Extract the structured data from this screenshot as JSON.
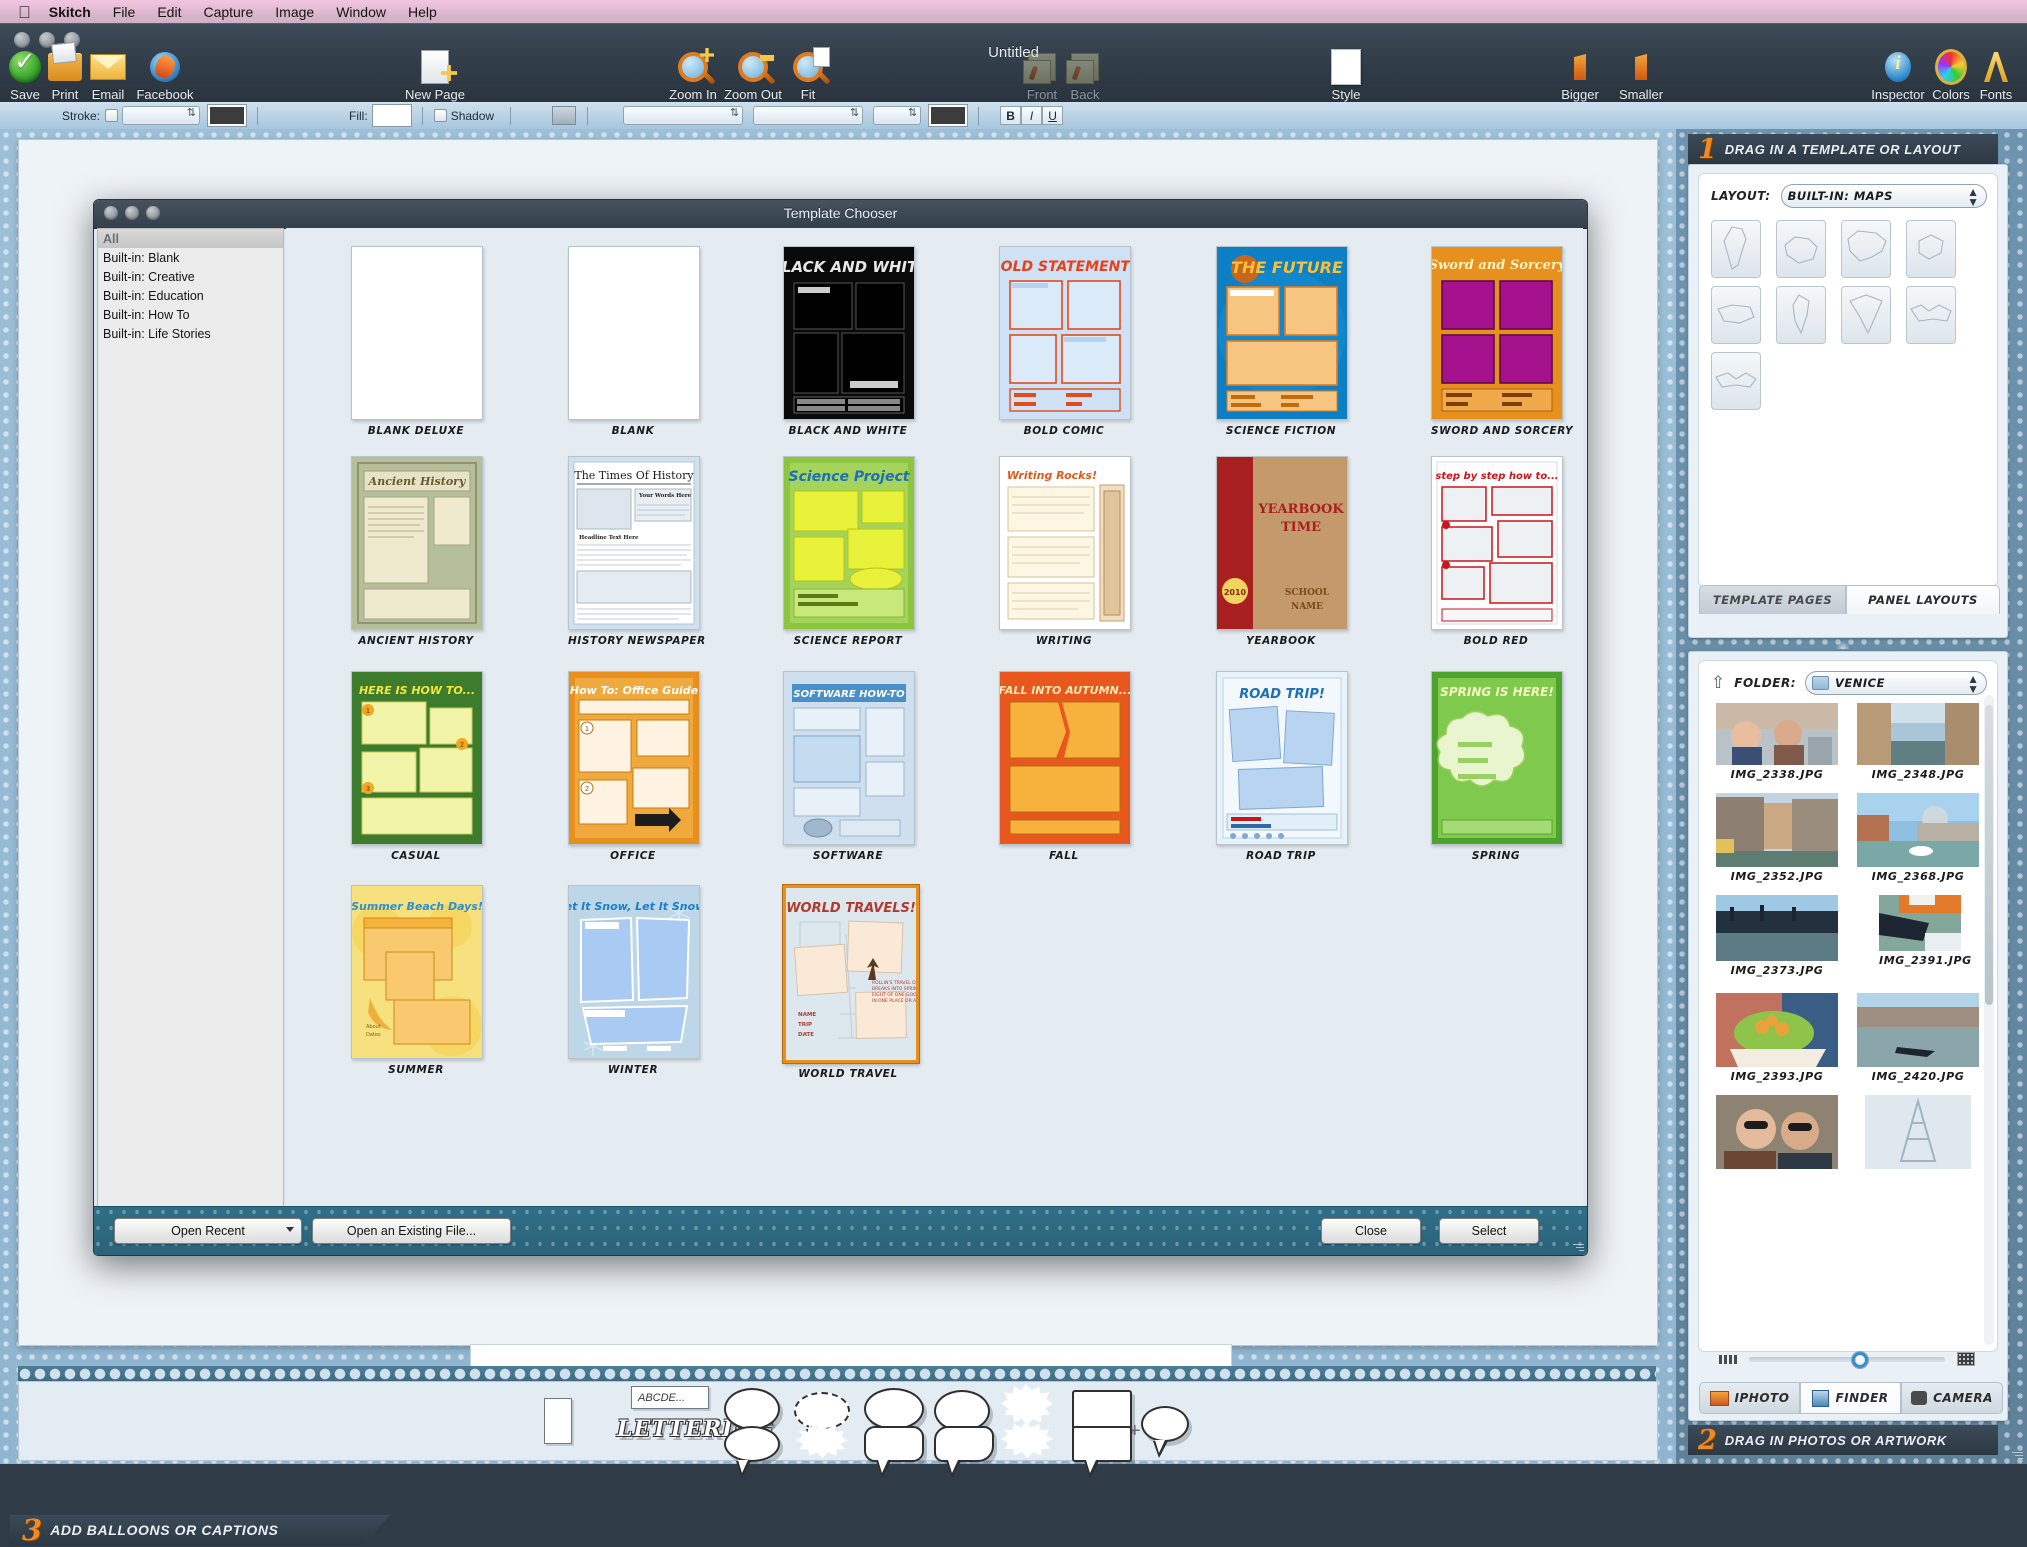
{
  "menubar": {
    "apple_icon": "apple-icon",
    "items": [
      {
        "label": "Skitch",
        "bold": true
      },
      {
        "label": "File"
      },
      {
        "label": "Edit"
      },
      {
        "label": "Capture"
      },
      {
        "label": "Image"
      },
      {
        "label": "Window"
      },
      {
        "label": "Help"
      }
    ]
  },
  "window": {
    "title": "Untitled",
    "toolbar": [
      {
        "label": "Save",
        "icon": "save-checkmark-icon",
        "enabled": true
      },
      {
        "label": "Print",
        "icon": "printer-icon",
        "enabled": true
      },
      {
        "label": "Email",
        "icon": "envelope-icon",
        "enabled": true
      },
      {
        "label": "Facebook",
        "icon": "facebook-globe-icon",
        "enabled": true
      },
      {
        "label": "New Page",
        "icon": "new-page-icon",
        "enabled": true
      },
      {
        "label": "Zoom In",
        "icon": "magnifier-plus-icon",
        "enabled": true
      },
      {
        "label": "Zoom Out",
        "icon": "magnifier-minus-icon",
        "enabled": true
      },
      {
        "label": "Fit",
        "icon": "magnifier-fit-icon",
        "enabled": true
      },
      {
        "label": "Front",
        "icon": "bring-front-icon",
        "enabled": false
      },
      {
        "label": "Back",
        "icon": "send-back-icon",
        "enabled": false
      },
      {
        "label": "Style",
        "icon": "style-swatch-icon",
        "enabled": true
      },
      {
        "label": "Bigger",
        "icon": "arrow-up-bigger-icon",
        "enabled": true
      },
      {
        "label": "Smaller",
        "icon": "arrow-down-smaller-icon",
        "enabled": true
      },
      {
        "label": "Inspector",
        "icon": "info-inspector-icon",
        "enabled": true
      },
      {
        "label": "Colors",
        "icon": "color-wheel-icon",
        "enabled": true
      },
      {
        "label": "Fonts",
        "icon": "font-a-icon",
        "enabled": true
      }
    ]
  },
  "format_bar": {
    "stroke_label": "Stroke:",
    "fill_label": "Fill:",
    "shadow_label": "Shadow",
    "stroke_color": "#3c3c3c",
    "fill_color": "#ffffff",
    "text_color": "#3c3c3c",
    "bold_label": "B",
    "italic_label": "I",
    "underline_label": "U"
  },
  "dialog": {
    "title": "Template Chooser",
    "sidebar": [
      {
        "label": "All",
        "selected": true
      },
      {
        "label": "Built-in: Blank",
        "selected": false
      },
      {
        "label": "Built-in: Creative",
        "selected": false
      },
      {
        "label": "Built-in: Education",
        "selected": false
      },
      {
        "label": "Built-in: How To",
        "selected": false
      },
      {
        "label": "Built-in: Life Stories",
        "selected": false
      }
    ],
    "buttons": {
      "open_recent": "Open Recent",
      "open_existing": "Open an Existing File...",
      "close": "Close",
      "select": "Select"
    },
    "templates": [
      {
        "name": "BLANK DELUXE",
        "style": "blank",
        "selected": false
      },
      {
        "name": "BLANK",
        "style": "blank",
        "selected": false
      },
      {
        "name": "BLACK AND WHITE",
        "title": "BLACK AND WHITE",
        "style": "bw",
        "selected": false
      },
      {
        "name": "BOLD COMIC",
        "title": "BOLD STATEMENTS",
        "style": "boldcomic",
        "selected": false
      },
      {
        "name": "SCIENCE FICTION",
        "title": "THE FUTURE",
        "style": "scifi",
        "selected": false
      },
      {
        "name": "SWORD AND SORCERY",
        "title": "Sword and Sorcery",
        "style": "sword",
        "selected": false
      },
      {
        "name": "ANCIENT HISTORY",
        "title": "Ancient History",
        "style": "ancient",
        "selected": false
      },
      {
        "name": "HISTORY NEWSPAPER",
        "title": "The Times Of History",
        "style": "newspaper",
        "selected": false
      },
      {
        "name": "SCIENCE REPORT",
        "title": "Science Project",
        "style": "science",
        "selected": false
      },
      {
        "name": "WRITING",
        "title": "Writing Rocks!",
        "style": "writing",
        "selected": false
      },
      {
        "name": "YEARBOOK",
        "title": "YEARBOOK TIME",
        "style": "yearbook",
        "selected": false
      },
      {
        "name": "BOLD RED",
        "title": "step by step how to...",
        "style": "boldred",
        "selected": false
      },
      {
        "name": "CASUAL",
        "title": "HERE IS HOW TO...",
        "style": "casual",
        "selected": false
      },
      {
        "name": "OFFICE",
        "title": "How To: Office Guide",
        "style": "office",
        "selected": false
      },
      {
        "name": "SOFTWARE",
        "title": "SOFTWARE HOW-TO",
        "style": "software",
        "selected": false
      },
      {
        "name": "FALL",
        "title": "FALL INTO AUTUMN...",
        "style": "fall",
        "selected": false
      },
      {
        "name": "ROAD TRIP",
        "title": "ROAD TRIP!",
        "style": "roadtrip",
        "selected": false
      },
      {
        "name": "SPRING",
        "title": "SPRING IS HERE!",
        "style": "spring",
        "selected": false
      },
      {
        "name": "SUMMER",
        "title": "Summer Beach Days!",
        "style": "summer",
        "selected": false
      },
      {
        "name": "WINTER",
        "title": "Let It Snow, Let It Snow!",
        "style": "winter",
        "selected": false
      },
      {
        "name": "WORLD TRAVEL",
        "title": "WORLD TRAVELS!",
        "style": "worldtravel",
        "selected": true
      }
    ]
  },
  "right_panel": {
    "step1": {
      "number": "1",
      "title": "DRAG IN A TEMPLATE OR LAYOUT"
    },
    "layout": {
      "label": "LAYOUT:",
      "value": "BUILT-IN: MAPS",
      "maps": [
        "africa",
        "australia",
        "asia",
        "europe",
        "usa",
        "south-america",
        "north-america",
        "world-flat",
        "world"
      ]
    },
    "tabs": [
      {
        "label": "TEMPLATE PAGES",
        "selected": true
      },
      {
        "label": "PANEL LAYOUTS",
        "selected": false
      }
    ],
    "step2": {
      "number": "2",
      "title": "DRAG IN PHOTOS OR ARTWORK"
    },
    "folder": {
      "label": "FOLDER:",
      "value": "VENICE",
      "icon": "folder-icon",
      "up_icon": "go-up-icon"
    },
    "photos": [
      {
        "name": "IMG_2338.JPG",
        "kind": "people-street"
      },
      {
        "name": "IMG_2348.JPG",
        "kind": "canal-narrow"
      },
      {
        "name": "IMG_2352.JPG",
        "kind": "canal-buildings"
      },
      {
        "name": "IMG_2368.JPG",
        "kind": "grand-canal-salute"
      },
      {
        "name": "IMG_2373.JPG",
        "kind": "gondolas-dock"
      },
      {
        "name": "IMG_2391.JPG",
        "kind": "gondola-boat"
      },
      {
        "name": "IMG_2393.JPG",
        "kind": "food-hands"
      },
      {
        "name": "IMG_2420.JPG",
        "kind": "grand-canal-gondola"
      },
      {
        "name": "",
        "kind": "two-women"
      },
      {
        "name": "",
        "kind": "eiffel-sketch"
      }
    ],
    "source_tabs": [
      {
        "label": "IPHOTO",
        "icon": "iphoto-icon",
        "selected": false
      },
      {
        "label": "FINDER",
        "icon": "finder-icon",
        "selected": true
      },
      {
        "label": "CAMERA",
        "icon": "camera-icon",
        "selected": false
      }
    ]
  },
  "balloons_pane": {
    "step3": {
      "number": "3",
      "title": "ADD BALLOONS OR CAPTIONS"
    },
    "text_sample": "ABCDE...",
    "lettering_sample": "LETTERING",
    "shapes": [
      "frame-box",
      "text-box",
      "lettering",
      "balloon-oval",
      "balloon-dashed-oval",
      "balloon-thought",
      "balloon-round",
      "balloon-burst",
      "balloon-rect",
      "balloon-add",
      "balloon-oval-2",
      "balloon-spiky-oval",
      "balloon-rounded-rect",
      "balloon-wobbly",
      "balloon-burst-2",
      "balloon-rect-2"
    ]
  }
}
